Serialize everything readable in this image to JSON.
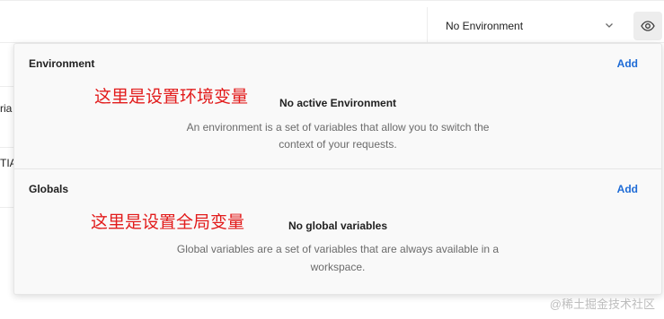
{
  "topbar": {
    "environment_select": {
      "value": "No Environment",
      "icon": "chevron-down-icon"
    },
    "quick_look_icon": "eye-icon"
  },
  "background": {
    "frag1": "ria",
    "frag2": "TIA"
  },
  "panel": {
    "environment": {
      "title": "Environment",
      "add_label": "Add",
      "annotation": "这里是设置环境变量",
      "empty_title": "No active Environment",
      "empty_desc_line1": "An environment is a set of variables that allow you to switch the",
      "empty_desc_line2": "context of your requests."
    },
    "globals": {
      "title": "Globals",
      "add_label": "Add",
      "annotation": "这里是设置全局变量",
      "empty_title": "No global variables",
      "empty_desc_line1": "Global variables are a set of variables that are always available in a",
      "empty_desc_line2": "workspace."
    }
  },
  "watermark": "@稀土掘金技术社区",
  "colors": {
    "accent": "#1e6bd6",
    "annotation": "#e21b1b",
    "panel_bg": "#f9f9f9"
  }
}
